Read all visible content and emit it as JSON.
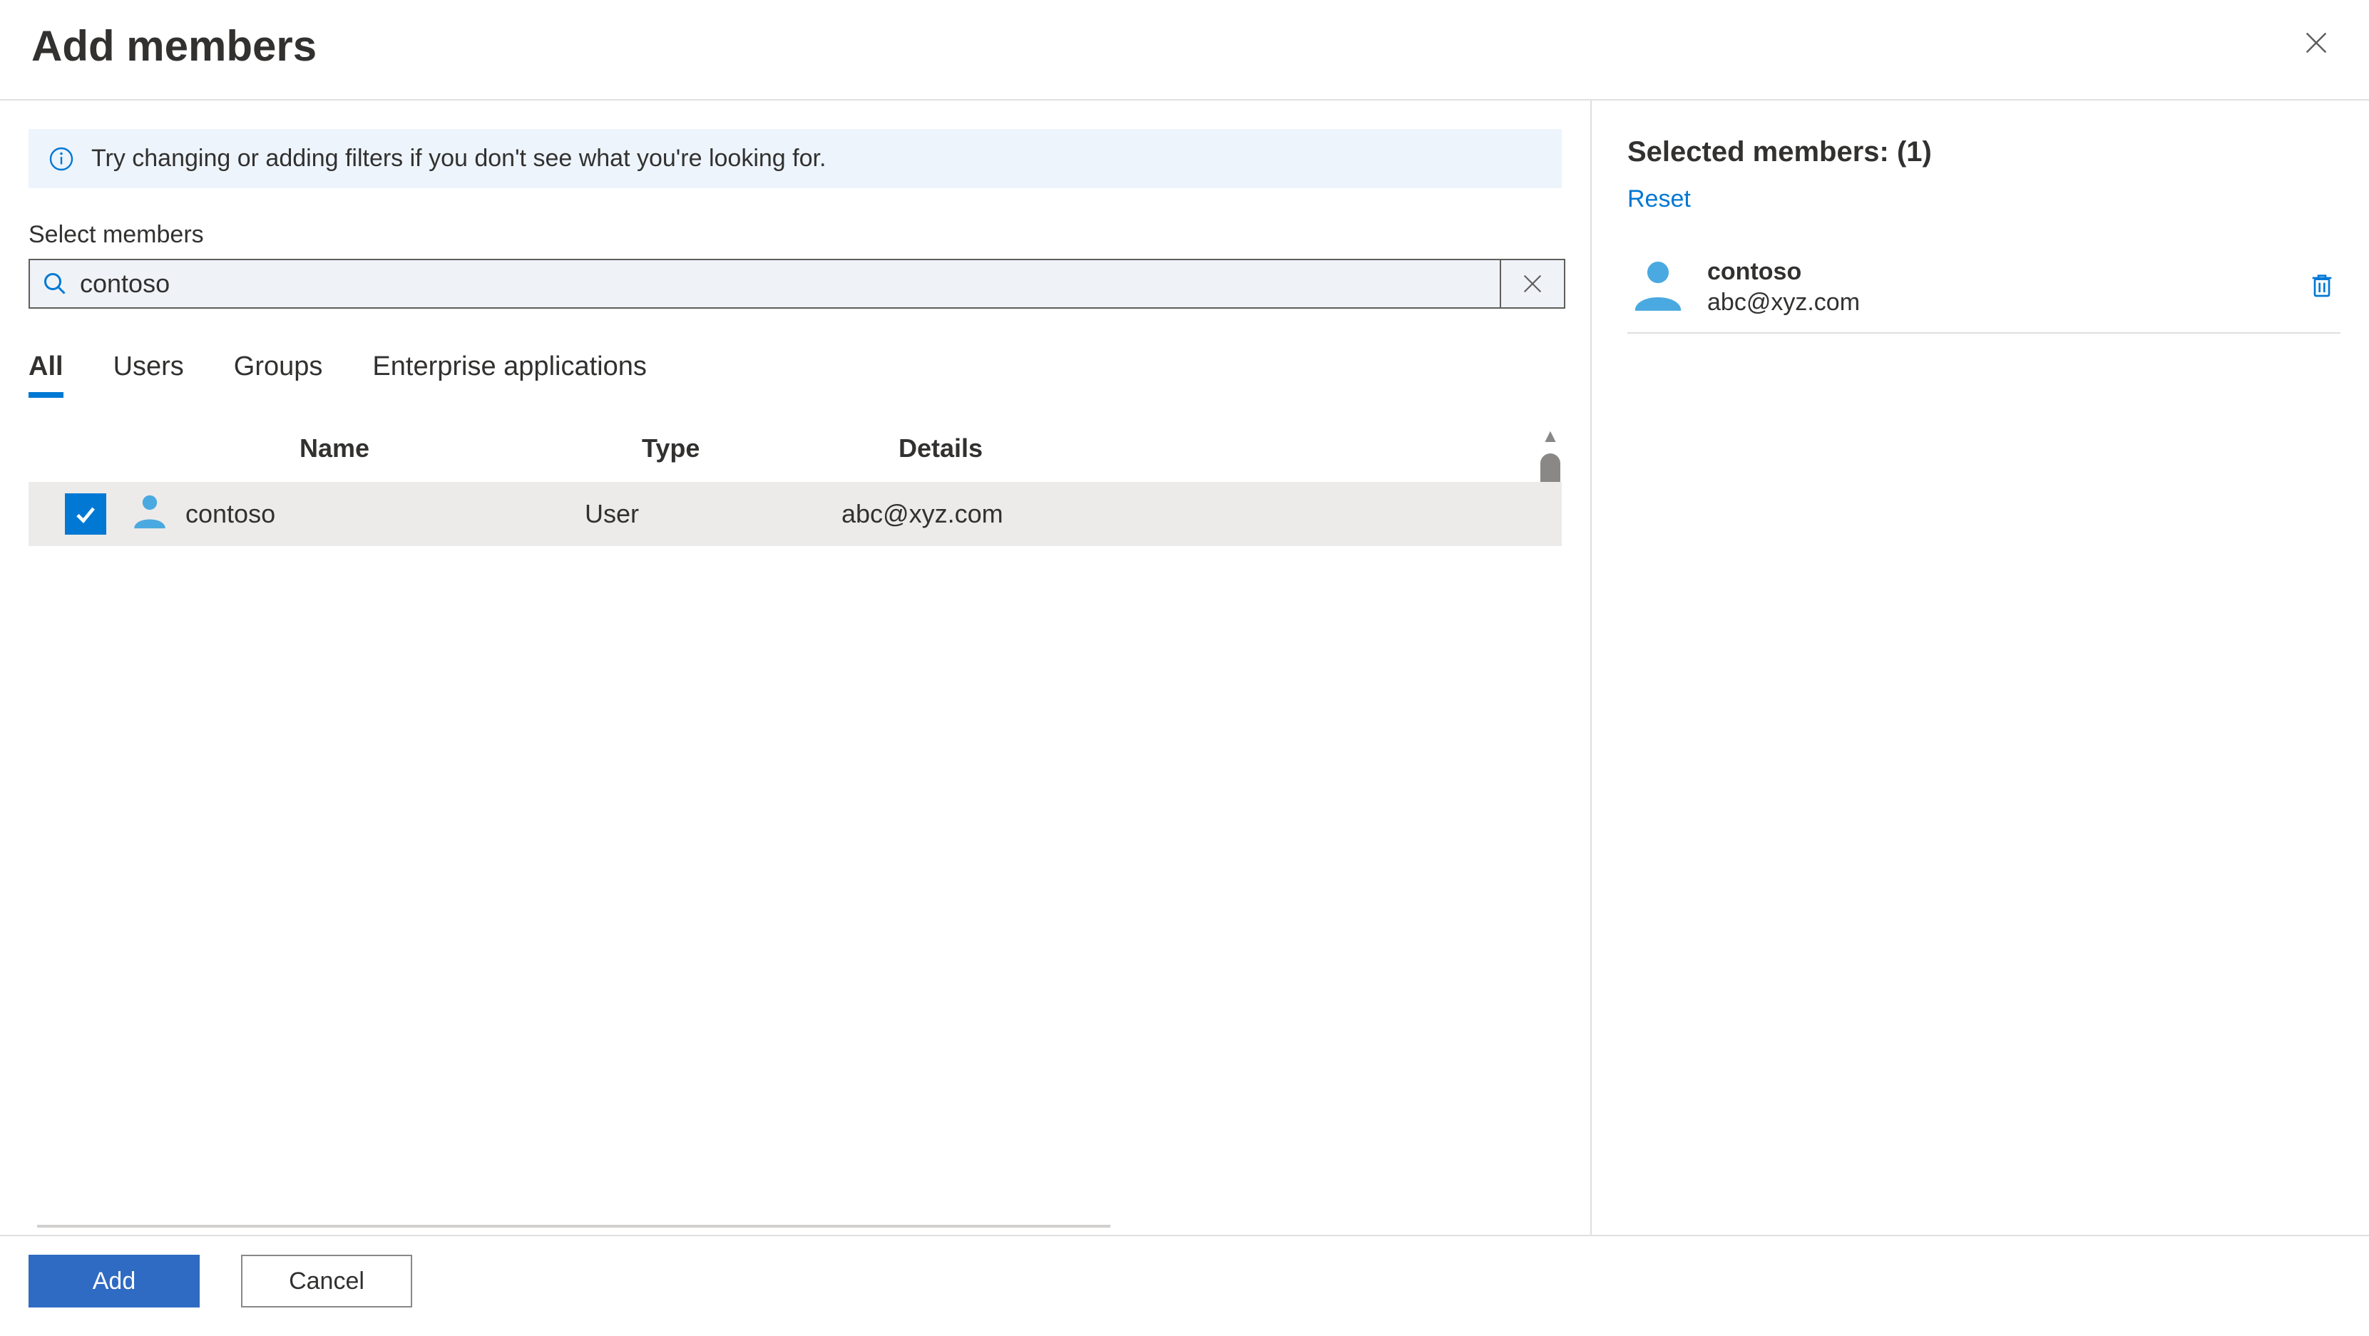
{
  "header": {
    "title": "Add members"
  },
  "info": {
    "message": "Try changing or adding filters if you don't see what you're looking for."
  },
  "search": {
    "label": "Select members",
    "value": "contoso",
    "placeholder": ""
  },
  "tabs": {
    "all": "All",
    "users": "Users",
    "groups": "Groups",
    "enterprise": "Enterprise applications",
    "active": "all"
  },
  "columns": {
    "name": "Name",
    "type": "Type",
    "details": "Details"
  },
  "results": [
    {
      "checked": true,
      "name": "contoso",
      "type": "User",
      "details": "abc@xyz.com"
    }
  ],
  "selected": {
    "heading_prefix": "Selected members: ",
    "count": "(1)",
    "reset": "Reset",
    "items": [
      {
        "name": "contoso",
        "detail": "abc@xyz.com"
      }
    ]
  },
  "footer": {
    "add": "Add",
    "cancel": "Cancel"
  }
}
